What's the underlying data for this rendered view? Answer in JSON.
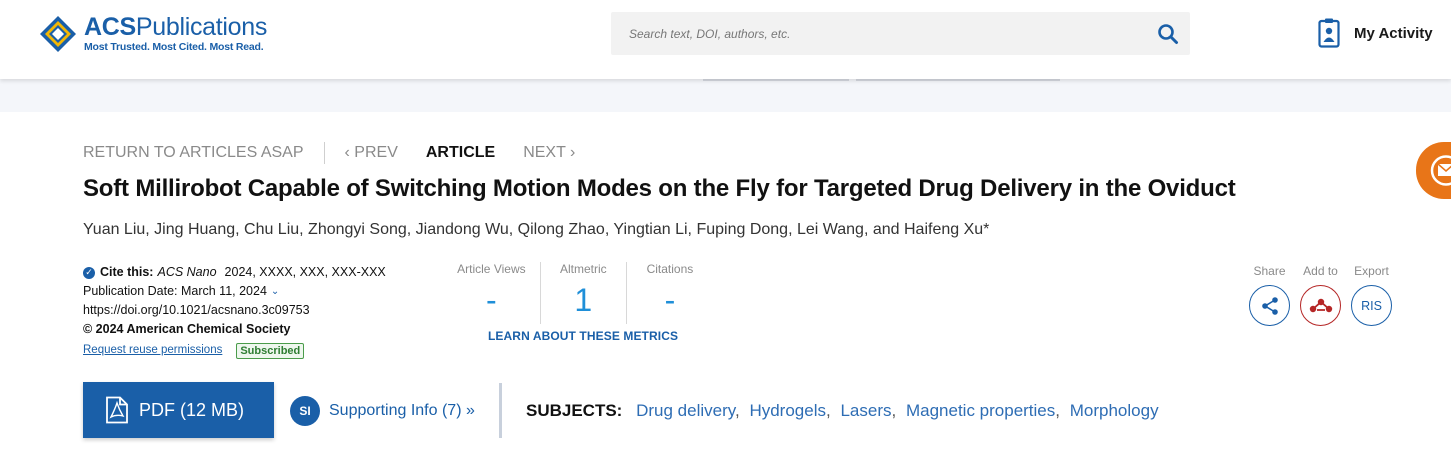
{
  "header": {
    "logo": {
      "title_bold": "ACS",
      "title_rest": "Publications",
      "tagline": "Most Trusted. Most Cited. Most Read."
    },
    "search": {
      "placeholder": "Search text, DOI, authors, etc."
    },
    "activity_label": "My Activity"
  },
  "article_nav": {
    "return_label": "RETURN TO ARTICLES ASAP",
    "prev_label": "PREV",
    "article_label": "ARTICLE",
    "next_label": "NEXT"
  },
  "article": {
    "title": "Soft Millirobot Capable of Switching Motion Modes on the Fly for Targeted Drug Delivery in the Oviduct",
    "authors": "Yuan Liu, Jing Huang, Chu Liu, Zhongyi Song, Jiandong Wu, Qilong Zhao, Yingtian Li, Fuping Dong, Lei Wang, and Haifeng Xu*"
  },
  "citation": {
    "cite_label": "Cite this:",
    "journal": "ACS Nano",
    "ref": "2024, XXXX, XXX, XXX-XXX",
    "pub_date": "Publication Date: March 11, 2024",
    "doi": "https://doi.org/10.1021/acsnano.3c09753",
    "copyright": "© 2024 American Chemical Society",
    "reuse_link": "Request reuse permissions",
    "subscribed_badge": "Subscribed"
  },
  "metrics": {
    "items": [
      {
        "label": "Article Views",
        "value": "-"
      },
      {
        "label": "Altmetric",
        "value": "1"
      },
      {
        "label": "Citations",
        "value": "-"
      }
    ],
    "learn_link": "LEARN ABOUT THESE METRICS"
  },
  "actions": {
    "share_label": "Share",
    "add_label": "Add to",
    "export_label": "Export",
    "export_button": "RIS"
  },
  "downloads": {
    "pdf_label": "PDF (12 MB)",
    "si_badge": "SI",
    "si_label": "Supporting Info (7) »"
  },
  "subjects": {
    "heading": "SUBJECTS:",
    "items": [
      "Drug delivery",
      "Hydrogels",
      "Lasers",
      "Magnetic properties",
      "Morphology"
    ]
  },
  "colors": {
    "brand_blue": "#1a5fa8",
    "metric_blue": "#1f8fd8",
    "email_orange": "#e87518",
    "add_red": "#b52626"
  }
}
